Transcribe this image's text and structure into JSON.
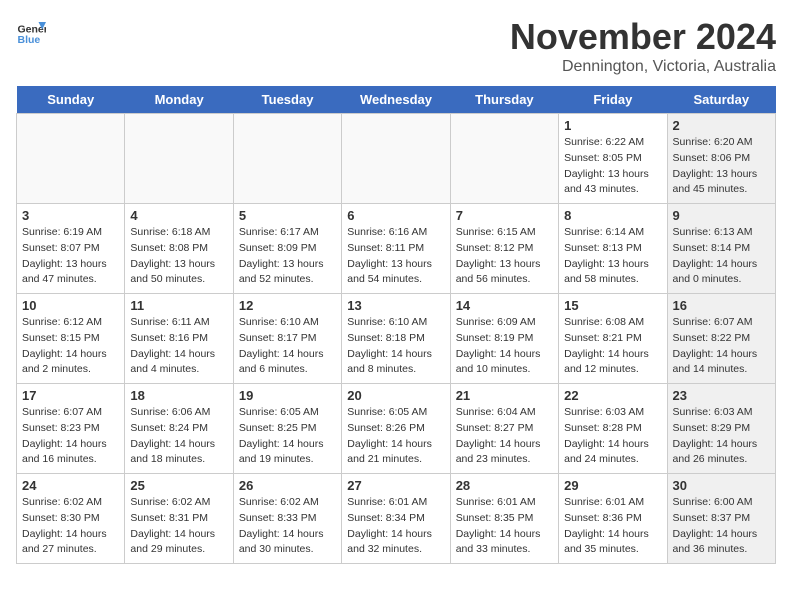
{
  "header": {
    "logo_line1": "General",
    "logo_line2": "Blue",
    "month_title": "November 2024",
    "subtitle": "Dennington, Victoria, Australia"
  },
  "weekdays": [
    "Sunday",
    "Monday",
    "Tuesday",
    "Wednesday",
    "Thursday",
    "Friday",
    "Saturday"
  ],
  "weeks": [
    [
      {
        "day": "",
        "info": "",
        "shaded": false,
        "empty": true
      },
      {
        "day": "",
        "info": "",
        "shaded": false,
        "empty": true
      },
      {
        "day": "",
        "info": "",
        "shaded": false,
        "empty": true
      },
      {
        "day": "",
        "info": "",
        "shaded": false,
        "empty": true
      },
      {
        "day": "",
        "info": "",
        "shaded": false,
        "empty": true
      },
      {
        "day": "1",
        "info": "Sunrise: 6:22 AM\nSunset: 8:05 PM\nDaylight: 13 hours\nand 43 minutes.",
        "shaded": false,
        "empty": false
      },
      {
        "day": "2",
        "info": "Sunrise: 6:20 AM\nSunset: 8:06 PM\nDaylight: 13 hours\nand 45 minutes.",
        "shaded": true,
        "empty": false
      }
    ],
    [
      {
        "day": "3",
        "info": "Sunrise: 6:19 AM\nSunset: 8:07 PM\nDaylight: 13 hours\nand 47 minutes.",
        "shaded": false,
        "empty": false
      },
      {
        "day": "4",
        "info": "Sunrise: 6:18 AM\nSunset: 8:08 PM\nDaylight: 13 hours\nand 50 minutes.",
        "shaded": false,
        "empty": false
      },
      {
        "day": "5",
        "info": "Sunrise: 6:17 AM\nSunset: 8:09 PM\nDaylight: 13 hours\nand 52 minutes.",
        "shaded": false,
        "empty": false
      },
      {
        "day": "6",
        "info": "Sunrise: 6:16 AM\nSunset: 8:11 PM\nDaylight: 13 hours\nand 54 minutes.",
        "shaded": false,
        "empty": false
      },
      {
        "day": "7",
        "info": "Sunrise: 6:15 AM\nSunset: 8:12 PM\nDaylight: 13 hours\nand 56 minutes.",
        "shaded": false,
        "empty": false
      },
      {
        "day": "8",
        "info": "Sunrise: 6:14 AM\nSunset: 8:13 PM\nDaylight: 13 hours\nand 58 minutes.",
        "shaded": false,
        "empty": false
      },
      {
        "day": "9",
        "info": "Sunrise: 6:13 AM\nSunset: 8:14 PM\nDaylight: 14 hours\nand 0 minutes.",
        "shaded": true,
        "empty": false
      }
    ],
    [
      {
        "day": "10",
        "info": "Sunrise: 6:12 AM\nSunset: 8:15 PM\nDaylight: 14 hours\nand 2 minutes.",
        "shaded": false,
        "empty": false
      },
      {
        "day": "11",
        "info": "Sunrise: 6:11 AM\nSunset: 8:16 PM\nDaylight: 14 hours\nand 4 minutes.",
        "shaded": false,
        "empty": false
      },
      {
        "day": "12",
        "info": "Sunrise: 6:10 AM\nSunset: 8:17 PM\nDaylight: 14 hours\nand 6 minutes.",
        "shaded": false,
        "empty": false
      },
      {
        "day": "13",
        "info": "Sunrise: 6:10 AM\nSunset: 8:18 PM\nDaylight: 14 hours\nand 8 minutes.",
        "shaded": false,
        "empty": false
      },
      {
        "day": "14",
        "info": "Sunrise: 6:09 AM\nSunset: 8:19 PM\nDaylight: 14 hours\nand 10 minutes.",
        "shaded": false,
        "empty": false
      },
      {
        "day": "15",
        "info": "Sunrise: 6:08 AM\nSunset: 8:21 PM\nDaylight: 14 hours\nand 12 minutes.",
        "shaded": false,
        "empty": false
      },
      {
        "day": "16",
        "info": "Sunrise: 6:07 AM\nSunset: 8:22 PM\nDaylight: 14 hours\nand 14 minutes.",
        "shaded": true,
        "empty": false
      }
    ],
    [
      {
        "day": "17",
        "info": "Sunrise: 6:07 AM\nSunset: 8:23 PM\nDaylight: 14 hours\nand 16 minutes.",
        "shaded": false,
        "empty": false
      },
      {
        "day": "18",
        "info": "Sunrise: 6:06 AM\nSunset: 8:24 PM\nDaylight: 14 hours\nand 18 minutes.",
        "shaded": false,
        "empty": false
      },
      {
        "day": "19",
        "info": "Sunrise: 6:05 AM\nSunset: 8:25 PM\nDaylight: 14 hours\nand 19 minutes.",
        "shaded": false,
        "empty": false
      },
      {
        "day": "20",
        "info": "Sunrise: 6:05 AM\nSunset: 8:26 PM\nDaylight: 14 hours\nand 21 minutes.",
        "shaded": false,
        "empty": false
      },
      {
        "day": "21",
        "info": "Sunrise: 6:04 AM\nSunset: 8:27 PM\nDaylight: 14 hours\nand 23 minutes.",
        "shaded": false,
        "empty": false
      },
      {
        "day": "22",
        "info": "Sunrise: 6:03 AM\nSunset: 8:28 PM\nDaylight: 14 hours\nand 24 minutes.",
        "shaded": false,
        "empty": false
      },
      {
        "day": "23",
        "info": "Sunrise: 6:03 AM\nSunset: 8:29 PM\nDaylight: 14 hours\nand 26 minutes.",
        "shaded": true,
        "empty": false
      }
    ],
    [
      {
        "day": "24",
        "info": "Sunrise: 6:02 AM\nSunset: 8:30 PM\nDaylight: 14 hours\nand 27 minutes.",
        "shaded": false,
        "empty": false
      },
      {
        "day": "25",
        "info": "Sunrise: 6:02 AM\nSunset: 8:31 PM\nDaylight: 14 hours\nand 29 minutes.",
        "shaded": false,
        "empty": false
      },
      {
        "day": "26",
        "info": "Sunrise: 6:02 AM\nSunset: 8:33 PM\nDaylight: 14 hours\nand 30 minutes.",
        "shaded": false,
        "empty": false
      },
      {
        "day": "27",
        "info": "Sunrise: 6:01 AM\nSunset: 8:34 PM\nDaylight: 14 hours\nand 32 minutes.",
        "shaded": false,
        "empty": false
      },
      {
        "day": "28",
        "info": "Sunrise: 6:01 AM\nSunset: 8:35 PM\nDaylight: 14 hours\nand 33 minutes.",
        "shaded": false,
        "empty": false
      },
      {
        "day": "29",
        "info": "Sunrise: 6:01 AM\nSunset: 8:36 PM\nDaylight: 14 hours\nand 35 minutes.",
        "shaded": false,
        "empty": false
      },
      {
        "day": "30",
        "info": "Sunrise: 6:00 AM\nSunset: 8:37 PM\nDaylight: 14 hours\nand 36 minutes.",
        "shaded": true,
        "empty": false
      }
    ]
  ]
}
